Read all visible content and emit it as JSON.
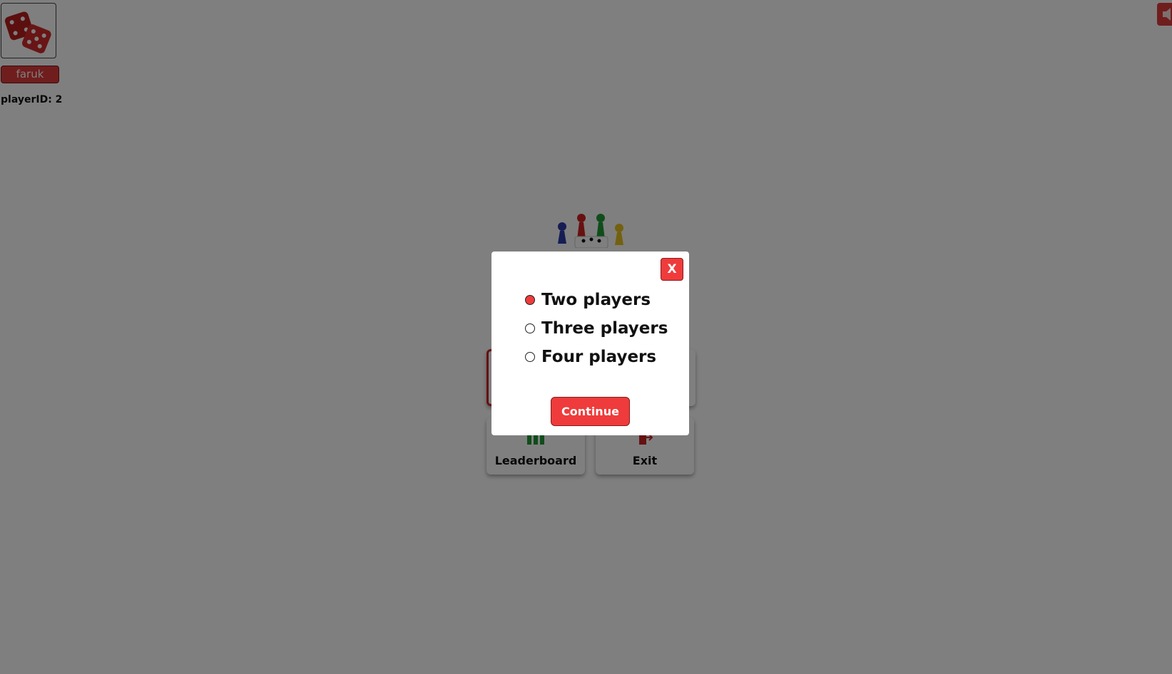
{
  "profile": {
    "username": "faruk",
    "player_id": "playerID: 2"
  },
  "menu": {
    "leaderboard_label": "Leaderboard",
    "exit_label": "Exit"
  },
  "modal": {
    "close_label": "X",
    "options": [
      {
        "label": "Two players",
        "selected": true
      },
      {
        "label": "Three players",
        "selected": false
      },
      {
        "label": "Four players",
        "selected": false
      }
    ],
    "continue_label": "Continue"
  },
  "colors": {
    "accent": "#ef3b3b",
    "overlay": "rgba(0,0,0,0.5)"
  },
  "icons": {
    "avatar": "red-dice-icon",
    "sound": "speaker-muted-icon",
    "logo": "ludo-pawns-dice-logo",
    "leaderboard": "bar-chart-icon",
    "exit": "exit-door-icon"
  }
}
